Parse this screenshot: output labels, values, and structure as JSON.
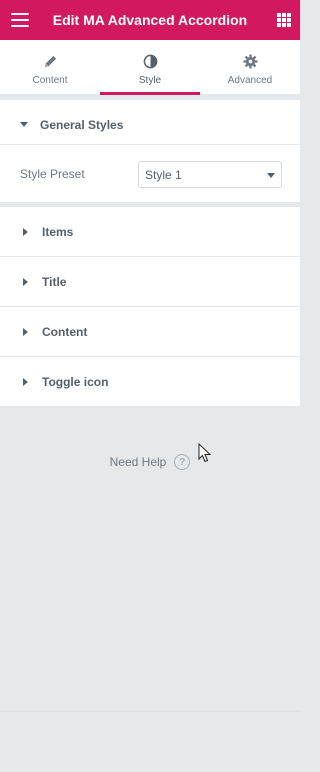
{
  "header": {
    "title": "Edit MA Advanced Accordion",
    "menu_icon": "hamburger-icon",
    "apps_icon": "grid-icon",
    "bar_color": "#d2185e"
  },
  "tabs": [
    {
      "label": "Content",
      "icon": "pencil-icon",
      "active": false
    },
    {
      "label": "Style",
      "icon": "half-circle-icon",
      "active": true
    },
    {
      "label": "Advanced",
      "icon": "gear-icon",
      "active": false
    }
  ],
  "sections": {
    "general": {
      "title": "General Styles",
      "expanded": true
    },
    "items": {
      "title": "Items",
      "expanded": false
    },
    "title": {
      "title": "Title",
      "expanded": false
    },
    "content": {
      "title": "Content",
      "expanded": false
    },
    "toggle": {
      "title": "Toggle icon",
      "expanded": false
    }
  },
  "style_preset": {
    "label": "Style Preset",
    "value": "Style 1"
  },
  "help": {
    "label": "Need Help",
    "icon": "question-circle-icon",
    "glyph": "?"
  }
}
